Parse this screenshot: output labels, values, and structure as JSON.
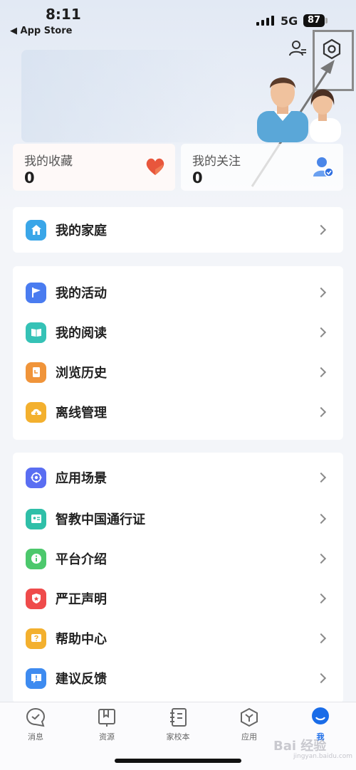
{
  "status": {
    "time": "8:11",
    "back_label": "◀ App Store",
    "network": "5G",
    "battery": "87"
  },
  "stats": {
    "favorites": {
      "label": "我的收藏",
      "count": "0",
      "icon": "heart-icon"
    },
    "following": {
      "label": "我的关注",
      "count": "0",
      "icon": "user-check-icon"
    }
  },
  "menu": {
    "family": {
      "label": "我的家庭",
      "icon": "home-icon",
      "color": "#3aa6e8"
    },
    "group1": [
      {
        "label": "我的活动",
        "icon": "flag-icon",
        "color": "#4a7cf0"
      },
      {
        "label": "我的阅读",
        "icon": "book-icon",
        "color": "#35c2b6"
      },
      {
        "label": "浏览历史",
        "icon": "history-icon",
        "color": "#f0943a"
      },
      {
        "label": "离线管理",
        "icon": "download-icon",
        "color": "#f3b02e"
      }
    ],
    "group2": [
      {
        "label": "应用场景",
        "icon": "scene-icon",
        "color": "#5a6ef2"
      },
      {
        "label": "智教中国通行证",
        "icon": "passport-icon",
        "color": "#2fbfa8"
      },
      {
        "label": "平台介绍",
        "icon": "info-icon",
        "color": "#4cc86c"
      },
      {
        "label": "严正声明",
        "icon": "shield-star-icon",
        "color": "#ef4b4b"
      },
      {
        "label": "帮助中心",
        "icon": "help-icon",
        "color": "#f3b02e"
      },
      {
        "label": "建议反馈",
        "icon": "feedback-icon",
        "color": "#3e8bf0"
      }
    ]
  },
  "tabs": [
    {
      "label": "消息",
      "icon": "message-icon"
    },
    {
      "label": "资源",
      "icon": "resource-icon"
    },
    {
      "label": "家校本",
      "icon": "notebook-icon"
    },
    {
      "label": "应用",
      "icon": "apps-icon"
    },
    {
      "label": "我",
      "icon": "me-icon",
      "active": true
    }
  ],
  "watermark": {
    "text": "Bai 经验",
    "sub": "jingyan.baidu.com"
  }
}
